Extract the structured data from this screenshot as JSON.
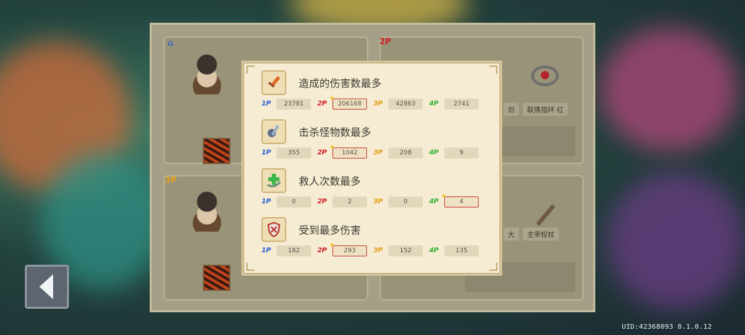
{
  "uid_text": "UID:42368093 8.1.0.12",
  "background_players": {
    "p1_tag": "⌂",
    "p2_tag": "2P",
    "p3_tag": "3P",
    "item_labels": [
      "剑",
      "联携指环 红",
      "大",
      "主宰权杖"
    ]
  },
  "stats": [
    {
      "title": "造成的伤害数最多",
      "icon": "sword-icon",
      "scores": [
        {
          "tag": "1P",
          "value": "23781",
          "best": false
        },
        {
          "tag": "2P",
          "value": "206168",
          "best": true
        },
        {
          "tag": "3P",
          "value": "42863",
          "best": false
        },
        {
          "tag": "4P",
          "value": "2741",
          "best": false
        }
      ]
    },
    {
      "title": "击杀怪物数最多",
      "icon": "kill-icon",
      "scores": [
        {
          "tag": "1P",
          "value": "355",
          "best": false
        },
        {
          "tag": "2P",
          "value": "1042",
          "best": true
        },
        {
          "tag": "3P",
          "value": "208",
          "best": false
        },
        {
          "tag": "4P",
          "value": "9",
          "best": false
        }
      ]
    },
    {
      "title": "救人次数最多",
      "icon": "rescue-icon",
      "scores": [
        {
          "tag": "1P",
          "value": "0",
          "best": false
        },
        {
          "tag": "2P",
          "value": "2",
          "best": false
        },
        {
          "tag": "3P",
          "value": "0",
          "best": false
        },
        {
          "tag": "4P",
          "value": "4",
          "best": true
        }
      ]
    },
    {
      "title": "受到最多伤害",
      "icon": "shield-icon",
      "scores": [
        {
          "tag": "1P",
          "value": "182",
          "best": false
        },
        {
          "tag": "2P",
          "value": "293",
          "best": true
        },
        {
          "tag": "3P",
          "value": "152",
          "best": false
        },
        {
          "tag": "4P",
          "value": "135",
          "best": false
        }
      ]
    }
  ],
  "colors": {
    "p1": "#2f5fd6",
    "p2": "#d0232a",
    "p3": "#e3a21c",
    "p4": "#3cb43a",
    "best_border": "#c5443b"
  }
}
